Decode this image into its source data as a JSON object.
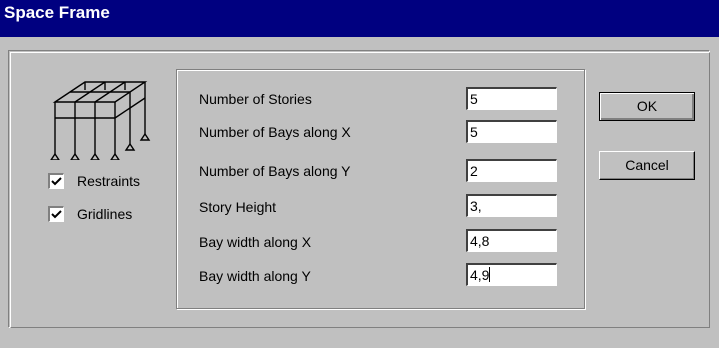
{
  "window": {
    "title": "Space Frame"
  },
  "options": {
    "restraints": {
      "label": "Restraints",
      "checked": true
    },
    "gridlines": {
      "label": "Gridlines",
      "checked": true
    }
  },
  "fields": [
    {
      "label": "Number of Stories",
      "value": "5"
    },
    {
      "label": "Number of Bays along X",
      "value": "5"
    },
    {
      "label": "Number of Bays along Y",
      "value": "2"
    },
    {
      "label": "Story Height",
      "value": "3,"
    },
    {
      "label": "Bay width along X",
      "value": "4,8"
    },
    {
      "label": "Bay width along Y",
      "value": "4,9"
    }
  ],
  "buttons": {
    "ok": "OK",
    "cancel": "Cancel"
  },
  "icons": {
    "frame": "space-frame-icon",
    "check": "checkmark-icon"
  },
  "colors": {
    "titlebar": "#000080",
    "dialog_face": "#c0c0c0"
  }
}
